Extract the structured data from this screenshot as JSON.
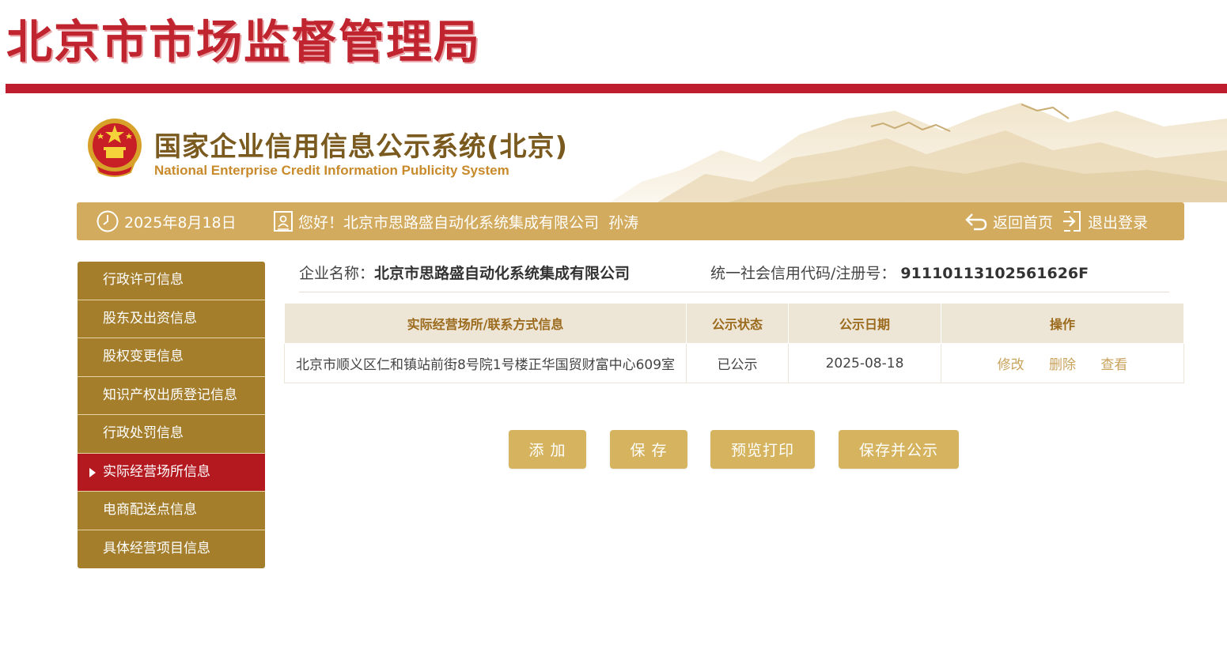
{
  "agency": {
    "title": "北京市市场监督管理局"
  },
  "system": {
    "title": "国家企业信用信息公示系统(北京)",
    "subtitle": "National Enterprise Credit Information Publicity System"
  },
  "topbar": {
    "date": "2025年8月18日",
    "greeting": "您好！北京市思路盛自动化系统集成有限公司  孙涛",
    "home_label": "返回首页",
    "logout_label": "退出登录"
  },
  "sidebar": {
    "items": [
      {
        "label": "行政许可信息"
      },
      {
        "label": "股东及出资信息"
      },
      {
        "label": "股权变更信息"
      },
      {
        "label": "知识产权出质登记信息"
      },
      {
        "label": "行政处罚信息"
      },
      {
        "label": "实际经营场所信息",
        "active": true
      },
      {
        "label": "电商配送点信息"
      },
      {
        "label": "具体经营项目信息"
      }
    ]
  },
  "company": {
    "name_label": "企业名称：",
    "name": "北京市思路盛自动化系统集成有限公司",
    "code_label": "统一社会信用代码/注册号：",
    "code": "91110113102561626F"
  },
  "table": {
    "headers": [
      "实际经营场所/联系方式信息",
      "公示状态",
      "公示日期",
      "操作"
    ],
    "rows": [
      {
        "address": "北京市顺义区仁和镇站前街8号院1号楼正华国贸财富中心609室",
        "status": "已公示",
        "date": "2025-08-18",
        "actions": [
          "修改",
          "删除",
          "查看"
        ]
      }
    ]
  },
  "buttons": {
    "add": "添 加",
    "save": "保 存",
    "preview_print": "预览打印",
    "save_publish": "保存并公示"
  },
  "colors": {
    "brand_red": "#be1e2d",
    "gold_bar": "#d3ab5e",
    "sidebar_brown": "#a57e2c",
    "sidebar_active": "#b3191f",
    "button_gold": "#d6b45f",
    "link_gold": "#c9a25c"
  },
  "icons": {
    "clock": "clock-icon",
    "user": "user-badge-icon",
    "home": "return-arrow-icon",
    "logout": "logout-icon",
    "emblem": "national-emblem-icon"
  }
}
